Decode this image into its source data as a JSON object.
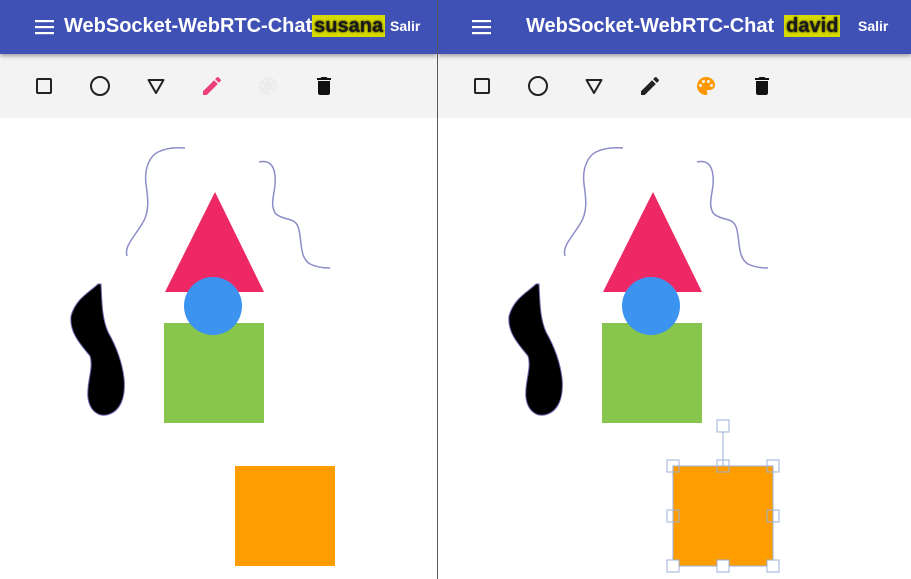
{
  "left_client": {
    "app_title": "WebSocket-WebRTC-Chat",
    "username": "susana",
    "logout_label": "Salir",
    "active_tool": "pen",
    "tools": [
      "square-icon",
      "circle-icon",
      "triangle-icon",
      "pencil-icon",
      "palette-icon",
      "trash-icon"
    ]
  },
  "right_client": {
    "app_title": "WebSocket-WebRTC-Chat",
    "username": "david",
    "logout_label": "Salir",
    "active_tool": "palette",
    "selected_shape": "orange-square",
    "tools": [
      "square-icon",
      "circle-icon",
      "triangle-icon",
      "pencil-icon",
      "palette-icon",
      "trash-icon"
    ]
  },
  "colors": {
    "appbar": "#3f51b5",
    "username_highlight": "#d7d900",
    "toolbar_bg": "#f3f3f3",
    "active_pencil": "#ec407a",
    "active_palette": "#ff9800",
    "triangle": "#ed2864",
    "circle": "#3c94f0",
    "square_green": "#88c54d",
    "square_orange": "#ff9c00",
    "freehand_line": "#8c8cc8",
    "blob": "#000000"
  }
}
